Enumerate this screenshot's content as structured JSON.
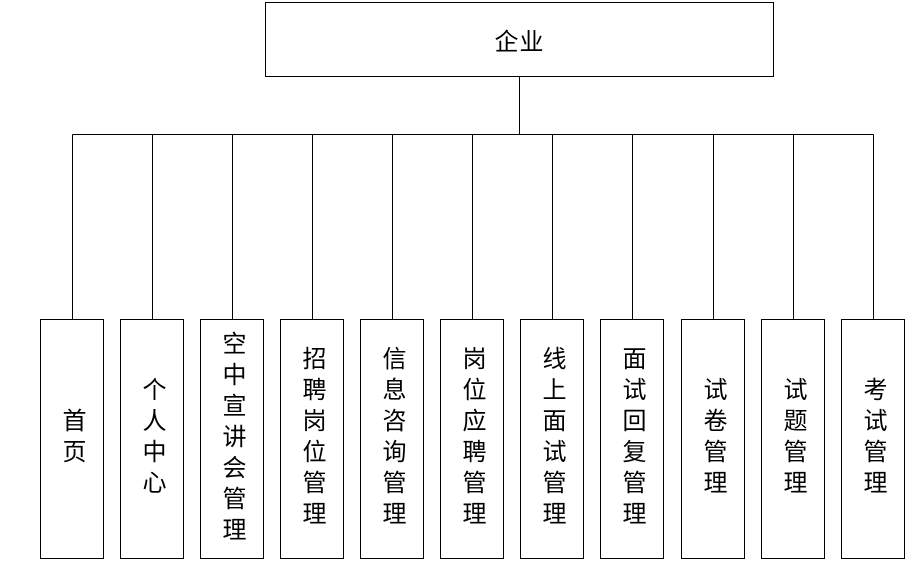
{
  "root": {
    "label": "企业"
  },
  "children": [
    {
      "label": "首页"
    },
    {
      "label": "个人中心"
    },
    {
      "label": "空中宣讲会管理"
    },
    {
      "label": "招聘岗位管理"
    },
    {
      "label": "信息咨询管理"
    },
    {
      "label": "岗位应聘管理"
    },
    {
      "label": "线上面试管理"
    },
    {
      "label": "面试回复管理"
    },
    {
      "label": "试卷管理"
    },
    {
      "label": "试题管理"
    },
    {
      "label": "考试管理"
    }
  ]
}
